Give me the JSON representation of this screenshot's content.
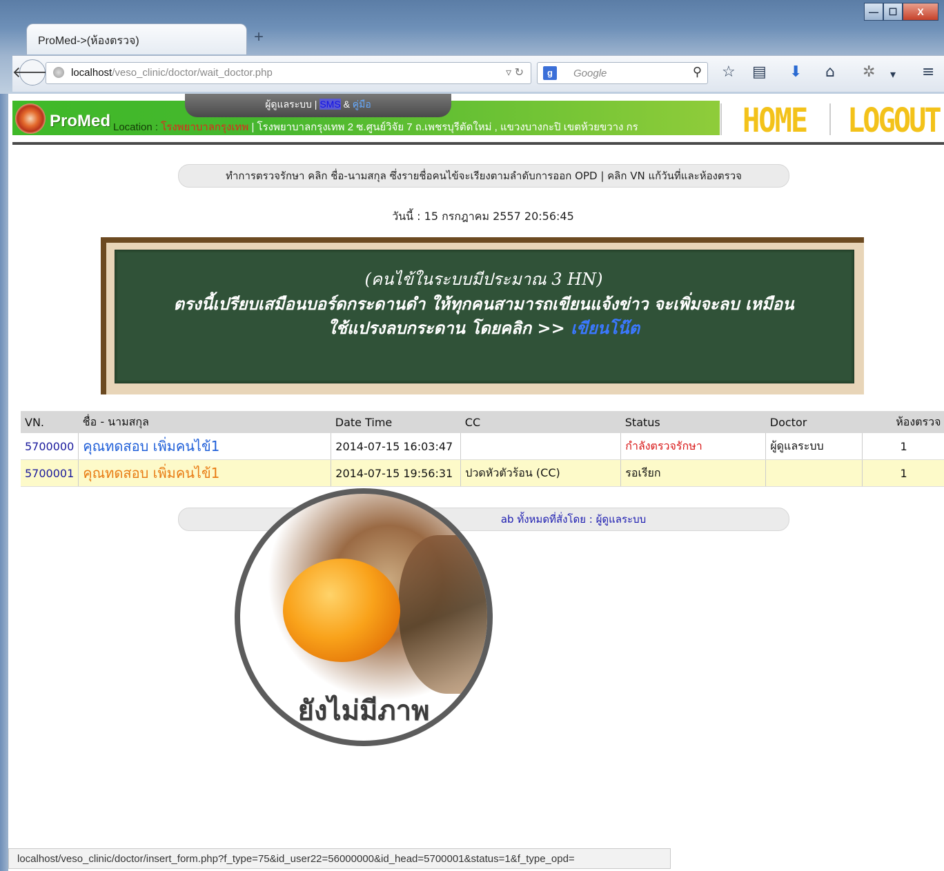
{
  "browser": {
    "tab_title": "ProMed->(ห้องตรวจ)",
    "url_host": "localhost",
    "url_path": "/veso_clinic/doctor/wait_doctor.php",
    "search_placeholder": "Google",
    "status_url": "localhost/veso_clinic/doctor/insert_form.php?f_type=75&id_user22=56000000&id_head=5700001&status=1&f_type_opd="
  },
  "header": {
    "logo": "ProMed",
    "location_label": "Location :",
    "hospital": "โรงพยาบาลกรุงเทพ",
    "address": "| โรงพยาบาลกรุงเทพ 2 ซ.ศูนย์วิจัย 7 ถ.เพชรบุรีตัดใหม่ , แขวงบางกะปิ เขตห้วยขวาง กร",
    "user": "ผู้ดูแลระบบ",
    "sep": "|",
    "sms": "SMS",
    "amp": "&",
    "manual": "คู่มือ",
    "home": "HOME",
    "logout": "LOGOUT"
  },
  "main": {
    "instruction": "ทำการตรวจรักษา คลิก ชื่อ-นามสกุล ซึ่งรายชื่อคนไข้จะเรียงตามลำดับการออก OPD | คลิก VN แก้วันที่และห้องตรวจ",
    "today": "วันนี้ : 15 กรกฎาคม 2557 20:56:45",
    "board_line1": "(คนไข้ในระบบมีประมาณ 3 HN)",
    "board_line2": "ตรงนี้เปรียบเสมือนบอร์ดกระดานดำ ให้ทุกคนสามารถเขียนแจ้งข่าว จะเพิ่มจะลบ เหมือน",
    "board_line3": "ใช้แปรงลบกระดาน โดยคลิก >>",
    "board_link": "เขียนโน๊ต",
    "lab_text": "ab ทั้งหมดที่สั่งโดย : ผู้ดูแลระบบ",
    "no_photo": "ยังไม่มีภาพ"
  },
  "table": {
    "headers": [
      "VN.",
      "ชื่อ - นามสกุล",
      "Date Time",
      "CC",
      "Status",
      "Doctor",
      "ห้องตรวจ"
    ],
    "rows": [
      {
        "vn": "5700000",
        "name": "คุณทดสอบ เพิ่มคนไข้1",
        "datetime": "2014-07-15 16:03:47",
        "cc": "",
        "status": "กำลังตรวจรักษา",
        "doctor": "ผู้ดูแลระบบ",
        "room": "1"
      },
      {
        "vn": "5700001",
        "name": "คุณทดสอบ เพิ่มคนไข้1",
        "datetime": "2014-07-15 19:56:31",
        "cc": "ปวดหัวตัวร้อน (CC)",
        "status": "รอเรียก",
        "doctor": "",
        "room": "1"
      }
    ]
  }
}
